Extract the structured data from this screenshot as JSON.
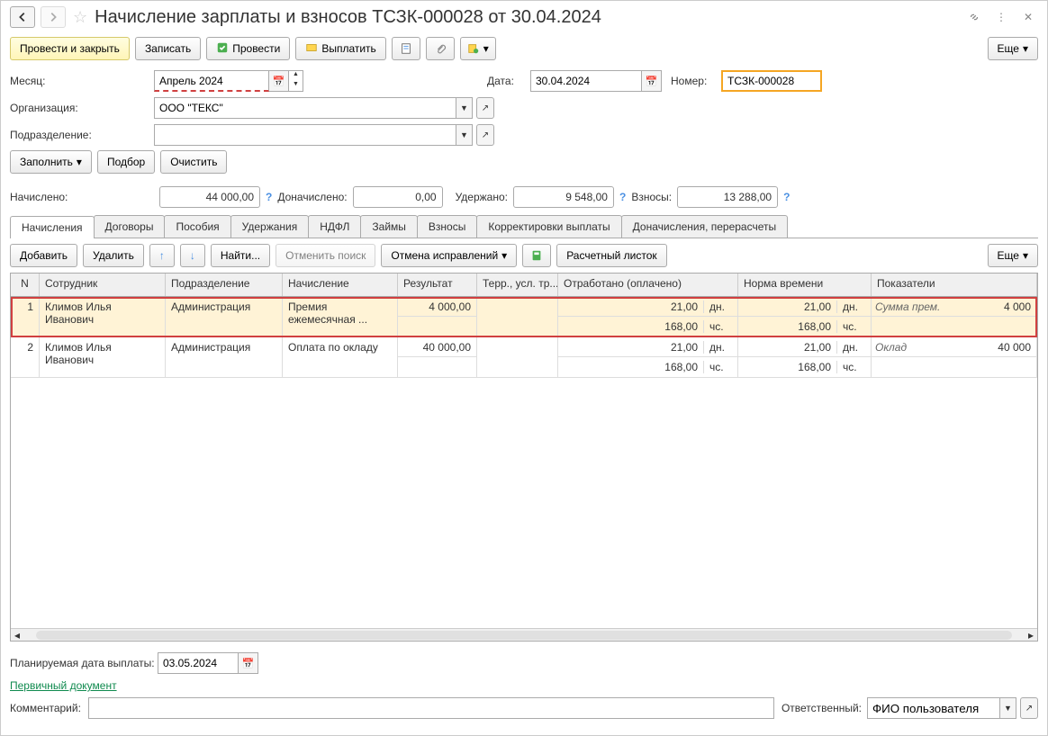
{
  "header": {
    "title": "Начисление зарплаты и взносов ТСЗК-000028 от 30.04.2024"
  },
  "toolbar": {
    "post_close": "Провести и закрыть",
    "save": "Записать",
    "post": "Провести",
    "pay": "Выплатить",
    "more": "Еще"
  },
  "form": {
    "month_label": "Месяц:",
    "month_value": "Апрель 2024",
    "date_label": "Дата:",
    "date_value": "30.04.2024",
    "number_label": "Номер:",
    "number_value": "ТСЗК-000028",
    "org_label": "Организация:",
    "org_value": "ООО \"ТЕКС\"",
    "dept_label": "Подразделение:",
    "dept_value": "",
    "fill_btn": "Заполнить",
    "pick_btn": "Подбор",
    "clear_btn": "Очистить"
  },
  "totals": {
    "accrued_label": "Начислено:",
    "accrued_value": "44 000,00",
    "doaccrued_label": "Доначислено:",
    "doaccrued_value": "0,00",
    "withheld_label": "Удержано:",
    "withheld_value": "9 548,00",
    "contrib_label": "Взносы:",
    "contrib_value": "13 288,00"
  },
  "tabs": [
    "Начисления",
    "Договоры",
    "Пособия",
    "Удержания",
    "НДФЛ",
    "Займы",
    "Взносы",
    "Корректировки выплаты",
    "Доначисления, перерасчеты"
  ],
  "subtoolbar": {
    "add": "Добавить",
    "delete": "Удалить",
    "find": "Найти...",
    "cancel_find": "Отменить поиск",
    "cancel_corr": "Отмена исправлений",
    "payslip": "Расчетный листок",
    "more": "Еще"
  },
  "grid": {
    "columns": {
      "n": "N",
      "employee": "Сотрудник",
      "dept": "Подразделение",
      "accrual": "Начисление",
      "result": "Результат",
      "terr": "Терр., усл. тр...",
      "worked": "Отработано (оплачено)",
      "norm": "Норма времени",
      "indicators": "Показатели"
    },
    "rows": [
      {
        "n": "1",
        "employee": "Климов Илья Иванович",
        "dept": "Администрация",
        "accrual": "Премия ежемесячная ...",
        "result": "4 000,00",
        "worked_days": "21,00",
        "worked_days_u": "дн.",
        "worked_hours": "168,00",
        "worked_hours_u": "чс.",
        "norm_days": "21,00",
        "norm_days_u": "дн.",
        "norm_hours": "168,00",
        "norm_hours_u": "чс.",
        "ind_label": "Сумма прем.",
        "ind_value": "4 000",
        "selected": true
      },
      {
        "n": "2",
        "employee": "Климов Илья Иванович",
        "dept": "Администрация",
        "accrual": "Оплата по окладу",
        "result": "40 000,00",
        "worked_days": "21,00",
        "worked_days_u": "дн.",
        "worked_hours": "168,00",
        "worked_hours_u": "чс.",
        "norm_days": "21,00",
        "norm_days_u": "дн.",
        "norm_hours": "168,00",
        "norm_hours_u": "чс.",
        "ind_label": "Оклад",
        "ind_value": "40 000",
        "selected": false
      }
    ]
  },
  "footer": {
    "planned_date_label": "Планируемая дата выплаты:",
    "planned_date_value": "03.05.2024",
    "primary_doc": "Первичный документ",
    "comment_label": "Комментарий:",
    "comment_value": "",
    "resp_label": "Ответственный:",
    "resp_value": "ФИО пользователя"
  }
}
